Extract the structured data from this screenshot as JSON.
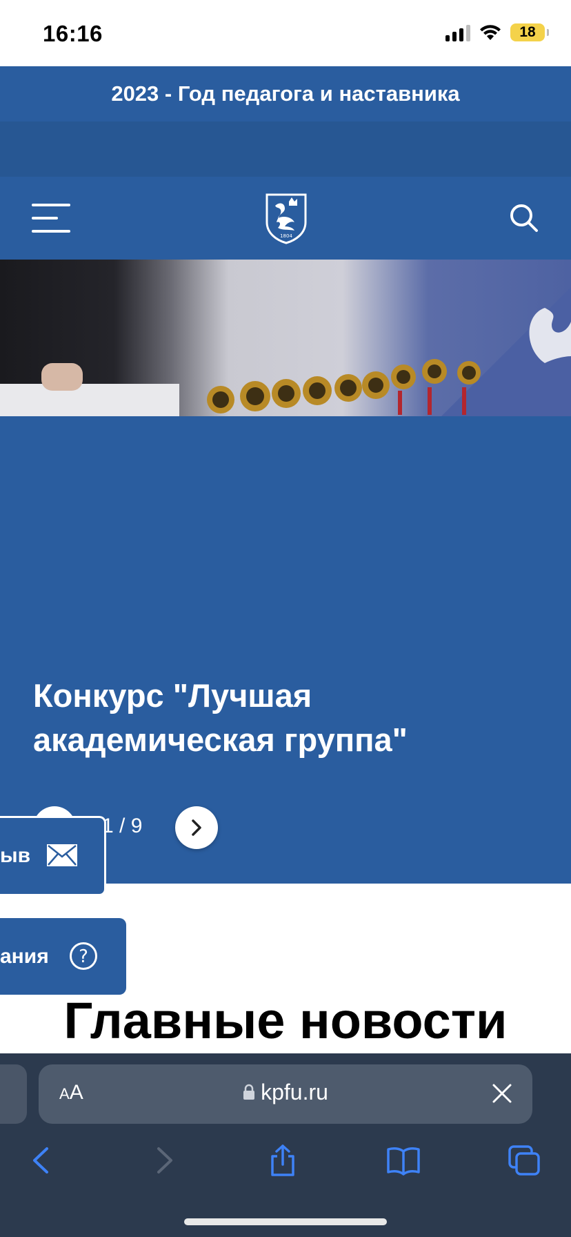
{
  "status_bar": {
    "time": "16:16",
    "battery": "18",
    "icons": [
      "cellular-signal-icon",
      "wifi-icon",
      "battery-icon"
    ]
  },
  "banner": {
    "text": "2023 - Год педагога и наставника",
    "color": "#2a5d9f"
  },
  "header": {
    "logo_text": "1804",
    "icons": [
      "hamburger-menu-icon",
      "kfu-logo",
      "search-icon"
    ]
  },
  "hero": {
    "title": "Конкурс \"Лучшая академическая группа\"",
    "counter": "1 / 9",
    "icons": [
      "chevron-left-icon",
      "chevron-right-icon"
    ]
  },
  "side_tabs": {
    "feedback_label": "ыв",
    "faq_label": "ания",
    "icons": [
      "envelope-icon",
      "question-circle-icon"
    ]
  },
  "main": {
    "section_heading": "Главные новости"
  },
  "safari": {
    "aa_small": "A",
    "aa_large": "A",
    "url": "kpfu.ru",
    "icons": [
      "lock-icon",
      "close-icon",
      "back-icon",
      "forward-icon",
      "share-icon",
      "bookmarks-icon",
      "tabs-icon"
    ]
  },
  "colors": {
    "brand_blue": "#2a5d9f",
    "safari_bar": "#2c3a4e",
    "battery_low": "#f4d24a"
  }
}
